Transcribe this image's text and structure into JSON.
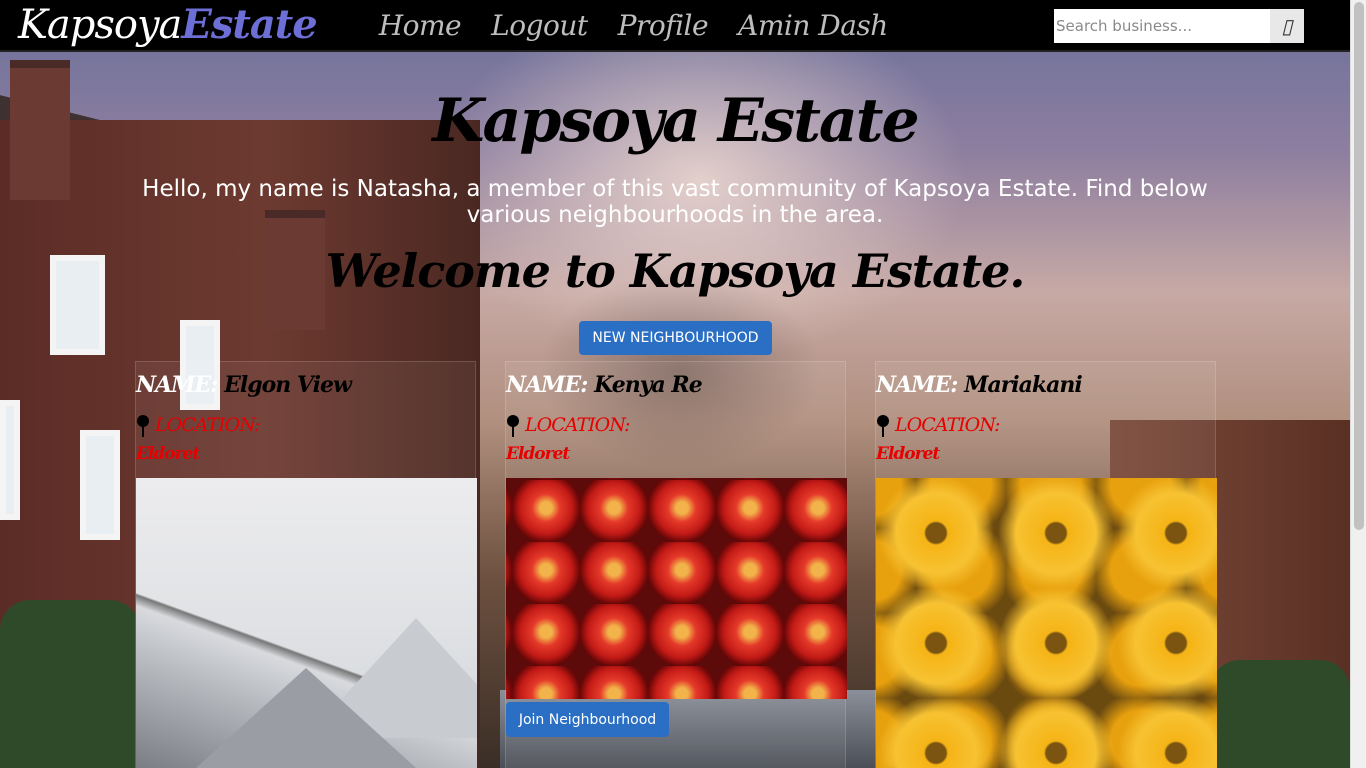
{
  "navbar": {
    "brand_part1": "Kapsoya",
    "brand_part2": "Estate",
    "links": [
      "Home",
      "Logout",
      "Profile",
      "Amin Dash"
    ],
    "search_placeholder": "Search business...",
    "search_button": "▯"
  },
  "hero": {
    "title": "Kapsoya Estate",
    "intro": "Hello, my name is Natasha, a member of this vast community of Kapsoya Estate. Find below various neighbourhoods in the area.",
    "welcome": "Welcome to Kapsoya Estate.",
    "new_button": "NEW NEIGHBOURHOOD"
  },
  "cards": [
    {
      "name_label": "NAME:",
      "name": "Elgon View",
      "location_label": "LOCATION:",
      "location": "Eldoret",
      "image": "snowy-mountain"
    },
    {
      "name_label": "NAME:",
      "name": "Kenya Re",
      "location_label": "LOCATION:",
      "location": "Eldoret",
      "image": "red-apples",
      "join_button": "Join Neighbourhood"
    },
    {
      "name_label": "NAME:",
      "name": "Mariakani",
      "location_label": "LOCATION:",
      "location": "Eldoret",
      "image": "yellow-flowers-bee"
    }
  ],
  "colors": {
    "navbar_bg": "#000000",
    "brand_accent": "#6d6fd6",
    "button_blue": "#2a6fc3",
    "location_red": "#e60000"
  }
}
